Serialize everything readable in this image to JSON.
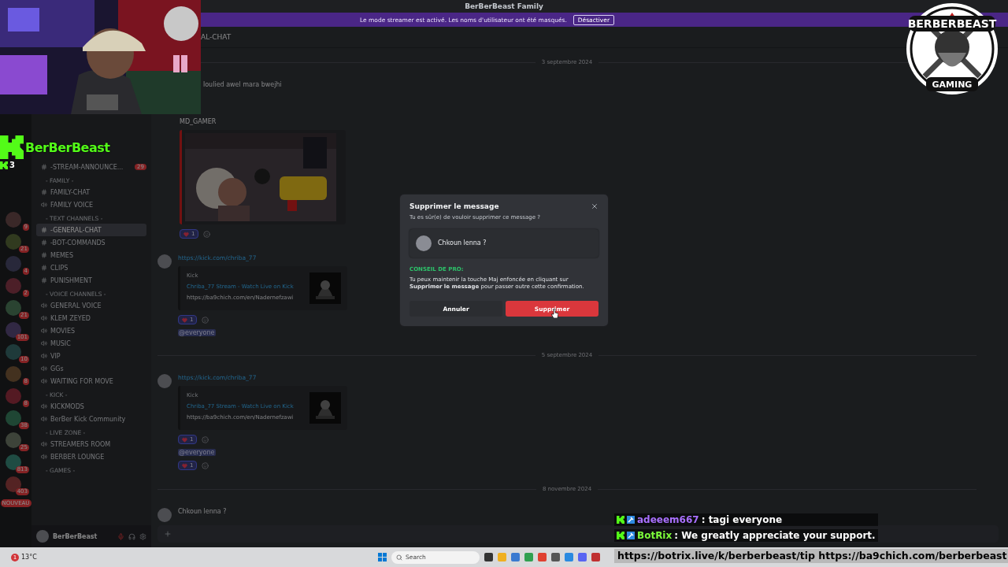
{
  "app": {
    "title": "BerBerBeast Family",
    "banner": {
      "text": "Le mode streamer est activé. Les noms d'utilisateur ont été masqués.",
      "button": "Désactiver"
    }
  },
  "servers": [
    {
      "badge": "9"
    },
    {
      "badge": "21"
    },
    {
      "badge": "4"
    },
    {
      "badge": "2"
    },
    {
      "badge": "21"
    },
    {
      "badge": "101"
    },
    {
      "badge": "10"
    },
    {
      "badge": "8"
    },
    {
      "badge": "8"
    },
    {
      "badge": "38"
    },
    {
      "badge": "25"
    },
    {
      "badge": "813"
    },
    {
      "badge": "403"
    }
  ],
  "new_label": "NOUVEAU",
  "categories": [
    {
      "channels": [
        {
          "name": "-STREAM-ANNOUNCE...",
          "kind": "text",
          "badge": "29",
          "selected": false
        }
      ]
    },
    {
      "name": "- FAMILY -",
      "channels": [
        {
          "name": "FAMILY-CHAT",
          "kind": "text",
          "selected": false
        },
        {
          "name": "FAMILY VOICE",
          "kind": "voice",
          "selected": false
        }
      ]
    },
    {
      "name": "- TEXT CHANNELS -",
      "channels": [
        {
          "name": "-GENERAL-CHAT",
          "kind": "text",
          "selected": true
        },
        {
          "name": "-BOT-COMMANDS",
          "kind": "text",
          "selected": false
        },
        {
          "name": "MEMES",
          "kind": "text",
          "selected": false
        },
        {
          "name": "CLIPS",
          "kind": "text",
          "selected": false
        },
        {
          "name": "PUNISHMENT",
          "kind": "text",
          "selected": false
        }
      ]
    },
    {
      "name": "- VOICE CHANNELS -",
      "channels": [
        {
          "name": "GENERAL VOICE",
          "kind": "voice",
          "selected": false
        },
        {
          "name": "KLEM ZEYED",
          "kind": "voice",
          "selected": false
        },
        {
          "name": "MOVIES",
          "kind": "voice",
          "selected": false
        },
        {
          "name": "MUSIC",
          "kind": "voice",
          "selected": false
        },
        {
          "name": "VIP",
          "kind": "voice",
          "selected": false
        },
        {
          "name": "GGs",
          "kind": "voice",
          "selected": false
        },
        {
          "name": "WAITING FOR MOVE",
          "kind": "voice",
          "selected": false
        }
      ]
    },
    {
      "name": "- KICK -",
      "channels": [
        {
          "name": "KICKMODS",
          "kind": "voice",
          "selected": false
        },
        {
          "name": "BerBer Kick Community",
          "kind": "voice",
          "selected": false
        }
      ]
    },
    {
      "name": "- LIVE ZONE -",
      "channels": [
        {
          "name": "STREAMERS ROOM",
          "kind": "voice",
          "selected": false
        },
        {
          "name": "BERBER LOUNGE",
          "kind": "voice",
          "selected": false
        }
      ]
    },
    {
      "name": "- GAMES -"
    }
  ],
  "user_panel": {
    "name": "BerBerBeast"
  },
  "channel_header": {
    "name": "AL-CHAT"
  },
  "messages": [
    {
      "kind": "date",
      "text": "3 septembre 2024"
    },
    {
      "kind": "text",
      "text": "loulied awel mara bwejhi",
      "avatar": false
    },
    {
      "kind": "video",
      "author": "MD_GAMER",
      "reaction": "1"
    },
    {
      "kind": "link",
      "link": "https://kick.com/chriba_77",
      "provider": "Kick",
      "title": "Chriba_77 Stream - Watch Live on Kick",
      "description": "https://ba9chich.com/en/Nadernefzawi",
      "reaction": "1",
      "mention": "@everyone"
    },
    {
      "kind": "date",
      "text": "5 septembre 2024"
    },
    {
      "kind": "link",
      "link": "https://kick.com/chriba_77",
      "provider": "Kick",
      "title": "Chriba_77 Stream - Watch Live on Kick",
      "description": "https://ba9chich.com/en/Nadernefzawi",
      "reaction": "1",
      "mention": "@everyone",
      "reaction2": "1"
    },
    {
      "kind": "date",
      "text": "8 novembre 2024"
    },
    {
      "kind": "text",
      "text": "Chkoun lenna ?",
      "avatar": true
    }
  ],
  "dialog": {
    "title": "Supprimer le message",
    "subtitle": "Tu es sûr(e) de vouloir supprimer ce message ?",
    "preview": "Chkoun lenna ?",
    "tip_label": "CONSEIL DE PRO:",
    "tip": "Tu peux maintenir la touche Maj enfoncée en cliquant sur **Supprimer le message** pour passer outre cette confirmation.",
    "cancel": "Annuler",
    "confirm": "Supprimer"
  },
  "stream_overlay": {
    "kick_name": "BerBerBeast",
    "viewers": "3",
    "logo_top": "BERBERBEAST",
    "logo_bottom": "GAMING",
    "chat": [
      {
        "user": "adeeem667",
        "color": "#a970ff",
        "text": ": tagi everyone"
      },
      {
        "user": "BotRix",
        "color": "#7cfc3a",
        "text": ": We greatly appreciate your support."
      }
    ],
    "ticker": "https://botrix.live/k/berberbeast/tip https://ba9chich.com/berberbeast"
  },
  "taskbar": {
    "weather": "13°C",
    "alert": "1",
    "search": "Search"
  }
}
